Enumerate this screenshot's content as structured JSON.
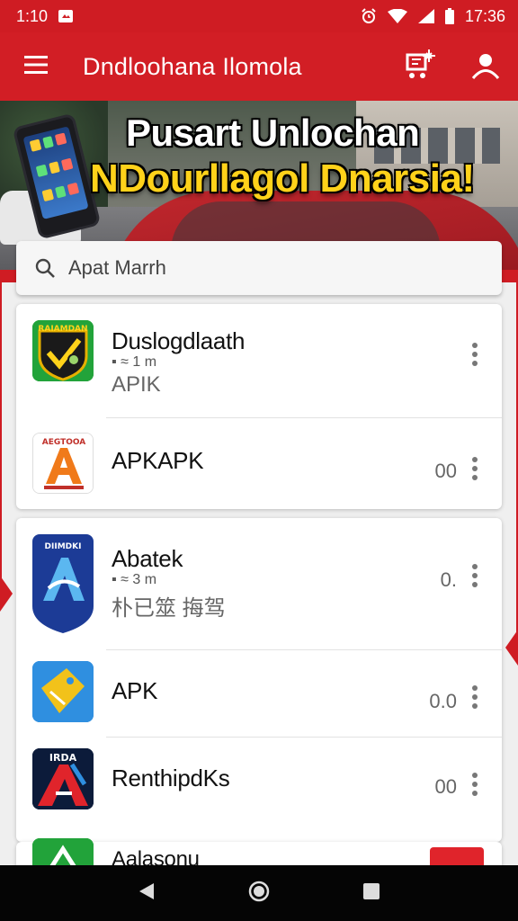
{
  "status_bar": {
    "time_left": "1:10",
    "time_right": "17:36"
  },
  "app_bar": {
    "title": "Dndloohana Ilomola"
  },
  "banner": {
    "line1": "Pusart Unlochan",
    "line2": "NDourllagol Dnarsia!"
  },
  "search": {
    "placeholder": "Apat Marrh"
  },
  "app_list": [
    {
      "title": "Duslogdlaath",
      "subtitle1": "▪ ≈ 1 m",
      "subtitle2": "APIK",
      "count": "",
      "icon_label": "RAIAMDAN"
    },
    {
      "title": "APKAPK",
      "subtitle1": "",
      "subtitle2": "",
      "count": "00",
      "icon_label": "AEGTOOA"
    },
    {
      "title": "Abatek",
      "subtitle1": "▪ ≈ 3 m",
      "subtitle2": "朴已筮 挴驾",
      "count": "0.",
      "icon_label": "DIIMDKI"
    },
    {
      "title": "APK",
      "subtitle1": "",
      "subtitle2": "",
      "count": "0.0",
      "icon_label": ""
    },
    {
      "title": "RenthipdKs",
      "subtitle1": "",
      "subtitle2": "",
      "count": "00",
      "icon_label": "IRDA"
    },
    {
      "title": "Aalasonu",
      "subtitle1": "",
      "subtitle2": "",
      "count": "",
      "icon_label": ""
    }
  ],
  "colors": {
    "brand_red": "#d21e25",
    "status_red": "#cf1c23",
    "banner_yellow": "#ffd21a"
  },
  "icons": {
    "menu": "hamburger-menu-icon",
    "cart": "cart-icon",
    "profile": "profile-icon",
    "search": "search-icon",
    "more": "more-vertical-icon",
    "back": "back-triangle-icon",
    "home": "home-circle-icon",
    "recents": "recents-square-icon"
  }
}
